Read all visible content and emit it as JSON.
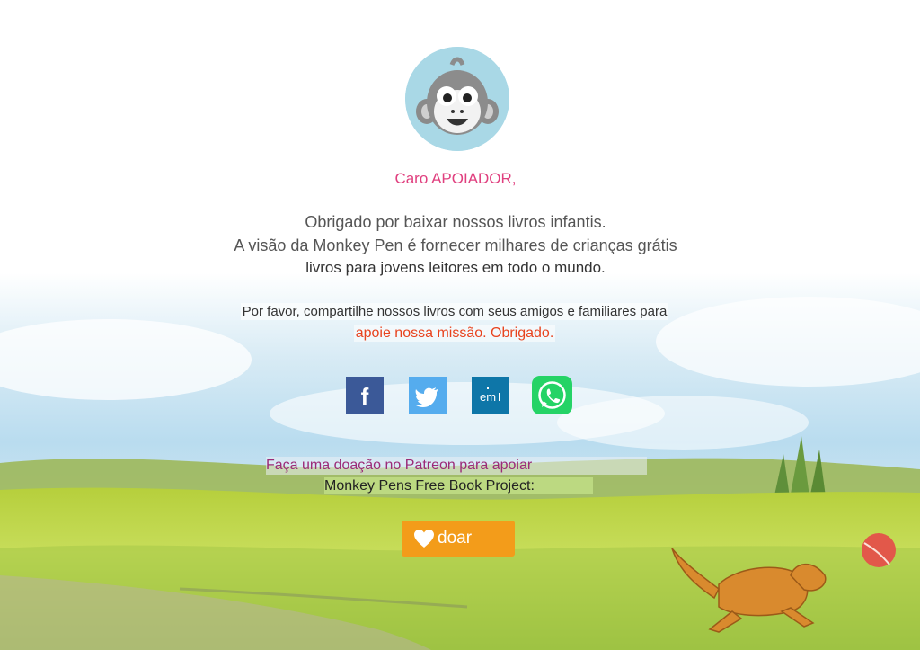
{
  "greeting": "Caro APOIADOR,",
  "intro": {
    "line1": "Obrigado por baixar nossos livros infantis.",
    "line2": "A visão da Monkey Pen é fornecer milhares de crianças grátis",
    "line3": "livros para jovens leitores em todo o mundo."
  },
  "share": {
    "line1": "Por favor, compartilhe nossos livros com seus amigos e familiares para",
    "line2": "apoie nossa missão. Obrigado."
  },
  "social": {
    "facebook_glyph": "f",
    "linkedin_glyph": "em",
    "icons": [
      "facebook-icon",
      "twitter-icon",
      "linkedin-icon",
      "whatsapp-icon"
    ]
  },
  "donate": {
    "line1": "Faça uma doação no Patreon para apoiar",
    "line2": "Monkey Pens Free Book Project:",
    "button_label": "doar"
  },
  "colors": {
    "greeting": "#e0407f",
    "mission": "#e8431e",
    "donate_button": "#f39c1a",
    "facebook": "#3b5998",
    "twitter": "#55acee",
    "linkedin": "#0e76a8",
    "whatsapp": "#25d366"
  }
}
